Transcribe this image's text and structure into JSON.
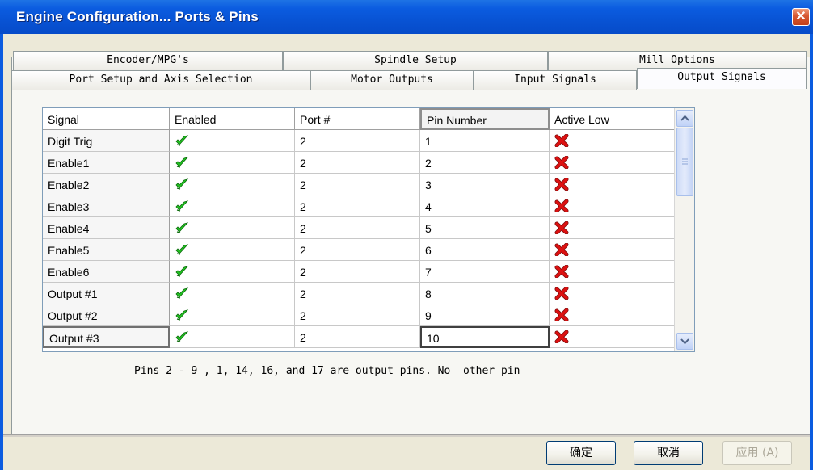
{
  "window": {
    "title": "Engine Configuration... Ports & Pins",
    "close_glyph": "✕"
  },
  "tabs": {
    "row1": [
      {
        "label": "Encoder/MPG's"
      },
      {
        "label": "Spindle Setup"
      },
      {
        "label": "Mill Options"
      }
    ],
    "row2": [
      {
        "label": "Port Setup and Axis Selection"
      },
      {
        "label": "Motor Outputs"
      },
      {
        "label": "Input Signals"
      },
      {
        "label": "Output Signals",
        "active": true
      }
    ]
  },
  "grid": {
    "columns": [
      "Signal",
      "Enabled",
      "Port #",
      "Pin Number",
      "Active Low"
    ],
    "rows": [
      {
        "signal": "Digit Trig",
        "enabled": true,
        "port": "2",
        "pin": "1",
        "active_low": false
      },
      {
        "signal": "Enable1",
        "enabled": true,
        "port": "2",
        "pin": "2",
        "active_low": false
      },
      {
        "signal": "Enable2",
        "enabled": true,
        "port": "2",
        "pin": "3",
        "active_low": false
      },
      {
        "signal": "Enable3",
        "enabled": true,
        "port": "2",
        "pin": "4",
        "active_low": false
      },
      {
        "signal": "Enable4",
        "enabled": true,
        "port": "2",
        "pin": "5",
        "active_low": false
      },
      {
        "signal": "Enable5",
        "enabled": true,
        "port": "2",
        "pin": "6",
        "active_low": false
      },
      {
        "signal": "Enable6",
        "enabled": true,
        "port": "2",
        "pin": "7",
        "active_low": false
      },
      {
        "signal": "Output #1",
        "enabled": true,
        "port": "2",
        "pin": "8",
        "active_low": false
      },
      {
        "signal": "Output #2",
        "enabled": true,
        "port": "2",
        "pin": "9",
        "active_low": false
      },
      {
        "signal": "Output #3",
        "enabled": true,
        "port": "2",
        "pin": "10",
        "active_low": false
      }
    ],
    "icons": {
      "enabled": "green-check-icon",
      "disabled": "red-x-icon"
    },
    "colors": {
      "check": "#22c222",
      "x": "#dd1111"
    }
  },
  "info": {
    "text": "Pins 2 - 9 , 1, 14, 16, and 17 are output pins. No  other pin"
  },
  "buttons": {
    "ok": "确定",
    "cancel": "取消",
    "apply": "应用 (A)"
  }
}
